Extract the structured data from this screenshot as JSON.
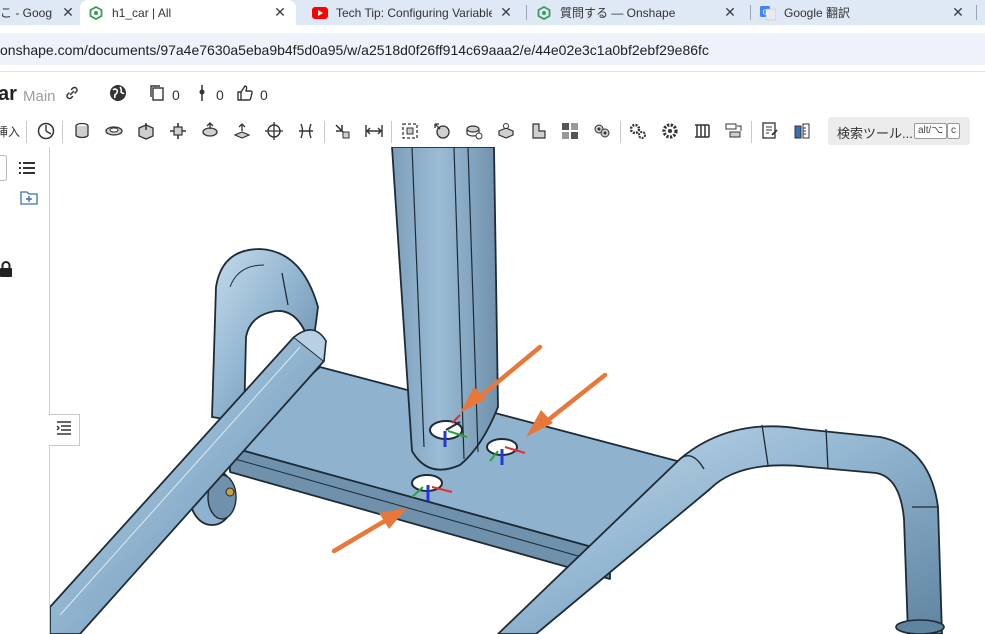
{
  "browser": {
    "tabs": [
      {
        "title": "こ - Goog",
        "icon": "google-drive-icon",
        "close": "✕"
      },
      {
        "title": "h1_car | All",
        "icon": "onshape-icon",
        "close": "✕"
      },
      {
        "title": "Tech Tip: Configuring Variables",
        "icon": "youtube-icon",
        "close": "✕"
      },
      {
        "title": "質問する — Onshape",
        "icon": "onshape-icon",
        "close": "✕"
      },
      {
        "title": "Google 翻訳",
        "icon": "google-translate-icon",
        "close": "✕"
      }
    ],
    "url": "onshape.com/documents/97a4e7630a5eba9b4f5d0a95/w/a2518d0f26ff914c69aaa2/e/44e02e3c1a0bf2ebf29e86fc"
  },
  "document": {
    "title": "ar",
    "branch": "Main",
    "counts": {
      "versions": "0",
      "branches": "0",
      "likes": "0"
    }
  },
  "toolbar": {
    "truncated_label": "挿入",
    "search_label": "検索ツール...",
    "shortcut_modifier": "alt/⌥",
    "shortcut_key": "c",
    "icons": [
      "sketch-icon",
      "extrude-icon",
      "revolve-icon",
      "sweep-icon",
      "loft-icon",
      "thicken-icon",
      "fillet-icon",
      "chamfer-icon",
      "draft-icon",
      "boolean-icon",
      "split-icon",
      "transform-icon",
      "pattern-icon",
      "mirror-icon",
      "hole-icon",
      "shell-icon",
      "rib-icon",
      "wrap-icon",
      "plane-icon",
      "mate-connector-icon",
      "helix-icon",
      "variable-icon",
      "configuration-icon",
      "feature-list-icon",
      "measure-icon"
    ]
  },
  "colors": {
    "tabstrip": "#dfe8f5",
    "part_blue": "#8fb3cf",
    "part_dark": "#5f849f",
    "edge": "#1e2b36",
    "arrow": "#e8773a"
  }
}
